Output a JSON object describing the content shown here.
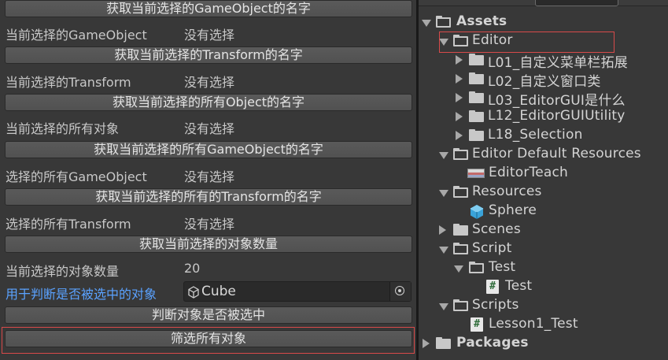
{
  "left_panel": {
    "btn_gameobject_name": "获取当前选择的GameObject的名字",
    "lbl_current_gameobject": "当前选择的GameObject",
    "val_current_gameobject": "没有选择",
    "btn_transform_name": "获取当前选择的Transform的名字",
    "lbl_current_transform": "当前选择的Transform",
    "val_current_transform": "没有选择",
    "btn_all_objects_name": "获取当前选择的所有Object的名字",
    "lbl_all_objects": "当前选择的所有对象",
    "val_all_objects": "没有选择",
    "btn_all_gameobjects_name": "获取当前选择的所有GameObject的名字",
    "lbl_all_gameobjects": "选择的所有GameObject",
    "val_all_gameobjects": "没有选择",
    "btn_all_transforms_name": "获取当前选择的所有的Transform的名字",
    "lbl_all_transforms": "选择的所有Transform",
    "val_all_transforms": "没有选择",
    "btn_count": "获取当前选择的对象数量",
    "lbl_count": "当前选择的对象数量",
    "val_count": "20",
    "lbl_check_object": "用于判断是否被选中的对象",
    "object_field_value": "Cube",
    "btn_check_selected": "判断对象是否被选中",
    "btn_filter_all": "筛选所有对象"
  },
  "project_tree": {
    "items": [
      {
        "label": "Assets",
        "icon": "folder-open-icon",
        "expanded": true
      },
      {
        "label": "Editor",
        "icon": "folder-open-icon",
        "expanded": true
      },
      {
        "label": "L01_自定义菜单栏拓展",
        "icon": "folder-icon"
      },
      {
        "label": "L02_自定义窗口类",
        "icon": "folder-icon"
      },
      {
        "label": "L03_EditorGUI是什么",
        "icon": "folder-icon"
      },
      {
        "label": "L12_EditorGUIUtility",
        "icon": "folder-icon"
      },
      {
        "label": "L18_Selection",
        "icon": "folder-icon"
      },
      {
        "label": "Editor Default Resources",
        "icon": "folder-open-icon",
        "expanded": true
      },
      {
        "label": "EditorTeach",
        "icon": "image-icon"
      },
      {
        "label": "Resources",
        "icon": "folder-open-icon",
        "expanded": true
      },
      {
        "label": "Sphere",
        "icon": "prefab-icon"
      },
      {
        "label": "Scenes",
        "icon": "folder-icon"
      },
      {
        "label": "Script",
        "icon": "folder-open-icon",
        "expanded": true
      },
      {
        "label": "Test",
        "icon": "folder-open-icon",
        "expanded": true
      },
      {
        "label": "Test",
        "icon": "csharp-script-icon"
      },
      {
        "label": "Scripts",
        "icon": "folder-open-icon",
        "expanded": true
      },
      {
        "label": "Lesson1_Test",
        "icon": "csharp-script-icon"
      },
      {
        "label": "Packages",
        "icon": "folder-icon"
      }
    ]
  },
  "colors": {
    "highlight_box": "#d84a4a",
    "link_label": "#5aa2ff"
  }
}
